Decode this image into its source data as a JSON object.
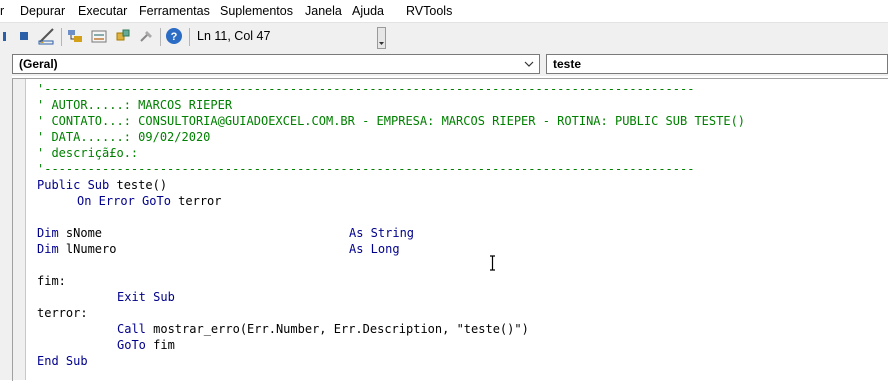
{
  "menu": {
    "items": [
      "r",
      "Depurar",
      "Executar",
      "Ferramentas",
      "Suplementos",
      "Janela",
      "Ajuda",
      "RVTools"
    ]
  },
  "toolbar": {
    "position_text": "Ln 11, Col 47",
    "icons": [
      "stop-icon",
      "reset-icon",
      "design-mode-icon",
      "project-explorer-icon",
      "properties-icon",
      "object-browser-icon",
      "toolbox-icon",
      "help-icon"
    ]
  },
  "object_combo": {
    "value": "(Geral)"
  },
  "procedure_combo": {
    "value": "teste"
  },
  "code": {
    "lines": [
      "'------------------------------------------------------------------------------------------",
      "' AUTOR.....: MARCOS RIEPER",
      "' CONTATO...: CONSULTORIA@GUIADOEXCEL.COM.BR - EMPRESA: MARCOS RIEPER - ROTINA: PUBLIC SUB TESTE()",
      "' DATA......: 09/02/2020",
      "' descriçã£o.:",
      "'------------------------------------------------------------------------------------------",
      "Public Sub teste()",
      "     On Error GoTo terror",
      "",
      "Dim sNome                             As String",
      "Dim lNumero                           As Long",
      "",
      "fim:",
      "          Exit Sub",
      "terror:",
      "          Call mostrar_erro(Err.Number, Err.Description, \"teste()\")",
      "          GoTo fim",
      "End Sub"
    ],
    "tokens": {
      "kw_public_sub": "Public Sub",
      "name_teste": " teste()",
      "kw_on_error_goto": "On Error GoTo",
      "name_terror": " terror",
      "kw_dim": "Dim",
      "var_snome": " sNome",
      "var_lnumero": " lNumero",
      "kw_as_string": "As String",
      "kw_as_long": "As Long",
      "label_fim": "fim:",
      "kw_exit_sub": "Exit Sub",
      "label_terror": "terror:",
      "kw_call": "Call",
      "call_rest": " mostrar_erro(Err.Number, Err.Description, \"teste()\")",
      "kw_goto": "GoTo",
      "goto_rest": " fim",
      "kw_end_sub": "End Sub"
    }
  },
  "colors": {
    "comment": "#008000",
    "keyword": "#00008b",
    "text": "#000000"
  }
}
